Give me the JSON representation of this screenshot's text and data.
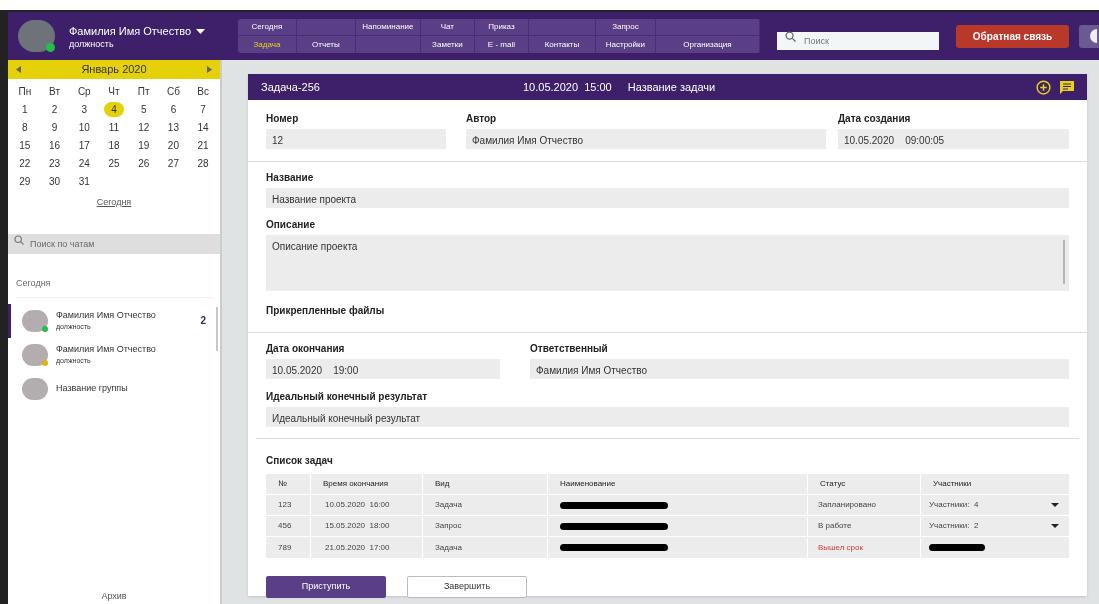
{
  "user": {
    "name": "Фамилия Имя Отчество",
    "role": "должность",
    "online": true
  },
  "nav": [
    [
      {
        "kind": "tab",
        "label": "Сегодня",
        "selected": false
      },
      {
        "kind": "blank"
      },
      {
        "kind": "tab",
        "label": "Напоминание",
        "selected": false
      },
      {
        "kind": "tab",
        "label": "Чат",
        "selected": false
      },
      {
        "kind": "tab",
        "label": "Приказ",
        "selected": false
      },
      {
        "kind": "blank"
      },
      {
        "kind": "tab",
        "label": "Запрос",
        "selected": false
      },
      {
        "kind": "blank"
      }
    ],
    [
      {
        "kind": "tab",
        "label": "Задача",
        "selected": true
      },
      {
        "kind": "tab",
        "label": "Отчеты",
        "selected": false
      },
      {
        "kind": "blank"
      },
      {
        "kind": "tab",
        "label": "Заметки",
        "selected": false
      },
      {
        "kind": "tab",
        "label": "E - mail",
        "selected": false
      },
      {
        "kind": "tab",
        "label": "Контакты",
        "selected": false
      },
      {
        "kind": "tab",
        "label": "Настройки",
        "selected": false
      },
      {
        "kind": "tab",
        "label": "Организация",
        "selected": false
      }
    ]
  ],
  "search": {
    "placeholder": "Поиск"
  },
  "feedback_button": "Обратная связь",
  "calendar": {
    "month": "Январь  2020",
    "weekdays": [
      "Пн",
      "Вт",
      "Ср",
      "Чт",
      "Пт",
      "Сб",
      "Вс"
    ],
    "days": [
      {
        "d": "1",
        "selected": false
      },
      {
        "d": "2",
        "selected": false
      },
      {
        "d": "3",
        "selected": false
      },
      {
        "d": "4",
        "selected": true
      },
      {
        "d": "5",
        "selected": false
      },
      {
        "d": "6",
        "selected": false
      },
      {
        "d": "7",
        "selected": false
      },
      {
        "d": "8",
        "selected": false
      },
      {
        "d": "9",
        "selected": false
      },
      {
        "d": "10",
        "selected": false
      },
      {
        "d": "11",
        "selected": false
      },
      {
        "d": "12",
        "selected": false
      },
      {
        "d": "13",
        "selected": false
      },
      {
        "d": "14",
        "selected": false
      },
      {
        "d": "15",
        "selected": false
      },
      {
        "d": "16",
        "selected": false
      },
      {
        "d": "17",
        "selected": false
      },
      {
        "d": "18",
        "selected": false
      },
      {
        "d": "19",
        "selected": false
      },
      {
        "d": "20",
        "selected": false
      },
      {
        "d": "21",
        "selected": false
      },
      {
        "d": "22",
        "selected": false
      },
      {
        "d": "23",
        "selected": false
      },
      {
        "d": "24",
        "selected": false
      },
      {
        "d": "25",
        "selected": false
      },
      {
        "d": "26",
        "selected": false
      },
      {
        "d": "27",
        "selected": false
      },
      {
        "d": "28",
        "selected": false
      },
      {
        "d": "29",
        "selected": false
      },
      {
        "d": "30",
        "selected": false
      },
      {
        "d": "31",
        "selected": false
      }
    ],
    "today_link": "Сегодня"
  },
  "chat_search": {
    "placeholder": "Поиск по чатам"
  },
  "chat_section": "Сегодня",
  "chats": [
    {
      "name": "Фамилия Имя Отчество",
      "role": "должность",
      "color": "#1fbf4a",
      "unread": "2",
      "selected": true
    },
    {
      "name": "Фамилия Имя Отчество",
      "role": "должность",
      "color": "#e8b00c",
      "selected": false
    },
    {
      "name": "Название группы",
      "selected": false
    }
  ],
  "archive": "Архив",
  "task": {
    "id": "Задача-256",
    "date": "10.05.2020  15:00",
    "title": "Название задачи",
    "number": {
      "label": "Номер",
      "value": "12"
    },
    "author": {
      "label": "Автор",
      "value": "Фамилия Имя Отчество"
    },
    "created": {
      "label": "Дата создания",
      "value": "10.05.2020    09:00:05"
    },
    "name": {
      "label": "Название",
      "value": "Название проекта"
    },
    "description": {
      "label": "Описание",
      "value": "Описание проекта"
    },
    "attachments": {
      "label": "Прикрепленные файлы"
    },
    "end_date": {
      "label": "Дата окончания",
      "value": "10.05.2020    19:00"
    },
    "responsible": {
      "label": "Ответственный",
      "value": "Фамилия Имя Отчество"
    },
    "result": {
      "label": "Идеальный конечный результат",
      "value": "Идеальный конечный результат"
    }
  },
  "subtasks": {
    "title": "Список задач",
    "columns": [
      "№",
      "Время окончания",
      "Вид",
      "Наименование",
      "Статус",
      "Участники"
    ],
    "rows": [
      {
        "no": "123",
        "end": "10.05.2020  16:00",
        "type": "Задача",
        "name_redacted": true,
        "status": "Запланировано",
        "overdue": false,
        "participants": "Участники:  4",
        "participants_redacted": false
      },
      {
        "no": "456",
        "end": "15.05.2020  18:00",
        "type": "Запрос",
        "name_redacted": true,
        "status": "В работе",
        "overdue": false,
        "participants": "Участники:  2",
        "participants_redacted": false
      },
      {
        "no": "789",
        "end": "21.05.2020  17:00",
        "type": "Задача",
        "name_redacted": true,
        "status": "Вышел срок",
        "overdue": true,
        "participants_redacted": true
      }
    ]
  },
  "actions": [
    {
      "label": "Приступить",
      "kind": "primary"
    },
    {
      "label": "Завершить",
      "kind": "secondary"
    }
  ]
}
